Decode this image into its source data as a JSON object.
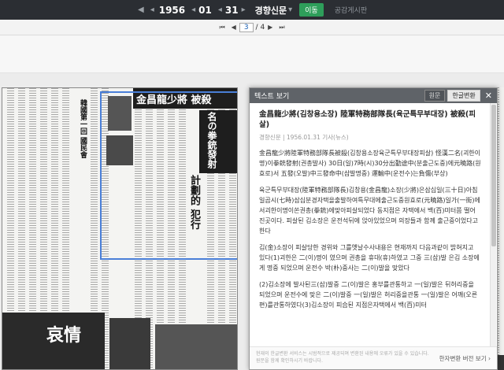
{
  "topbar": {
    "year": "1956",
    "month": "01",
    "day": "31",
    "publication": "경향신문",
    "move_button": "이동",
    "board_link": "공감게시판"
  },
  "pagebar": {
    "current_page": "3",
    "total_pages": "/ 4"
  },
  "text_panel": {
    "title": "텍스트 보기",
    "tabs": [
      "원문",
      "한글변환"
    ],
    "article_title": "金昌龍少將(김창용소장) 陸軍特務部隊長(육군특무부대장) 被殺(피살)",
    "meta": "경향신문 | 1956.01.31 기사(뉴스)",
    "paragraphs": [
      "金昌龍少將陸軍特務部隊長被殺(김창용소장육군특무부대장피살) 怪漢二名(괴한이명)이拳銃發射(권총발사) 30日(일)7時(시)30分出勤途中(분출근도중)에元曉路(원효로)서 五發(오발)中三發命中(삼발명중) 運輸中(운전수)는負傷(부상)",
      "육군특무부대장(陸軍特務部隊長)김창용(金昌龍)소장(少將)은삼십일(三十日)아침일곱시(七時)삼십분경자택을출발하여특무대에출근도중원효로(元曉路)일가(一街)에서괴한이명이쏜권총(拳銃)에맞아피살되었다 동지점은 자택에서 백(百)미터쯤 떨어진곳이다. 피살된 김소장은 운전석뒤에 앉아있었으며 의장들과 함께 출근중이었다고 한다",
      "김(金)소장이 피살당한 경위와 그를옛날수사내용은 현재까지 다음과같이 밝혀지고 있다(1)괴한은 二(이)명이 였으며 권총을 휴대(휴)하였고 그중 三(삼)발 은김 소장에게 명중 되었으며 운전수 박(朴)중사는 二(이)발을 맞았다",
      "(2)김소장에 발사된三(삼)발중 二(이)발은 홍부를관통하고 一(일)발은 뒤허리중을 되었으며 운전수에 맞은 二(이)발중 一(일)발은 허리중을관통 一(일)발은 어깨(오른편)를관통하였다(3)김소장이 피습된 지점은자택에서 백(百)미터"
    ],
    "footer_note": "현재의 한글변환 서비스는 시범적으로 제공되며 변환된 내용에 오류가 있을 수 있습니다. 원문을 함께 확인하시기 바랍니다.",
    "footer_link": "한자변환 버전 보기 ›"
  },
  "newspaper": {
    "headline_main": "金昌龍少將 被殺",
    "headline_sub": "名の拳銃發射",
    "headline_right": "計劃的 犯行",
    "headline_left": "韓國第一回 國民會",
    "ad_title": "哀情"
  }
}
